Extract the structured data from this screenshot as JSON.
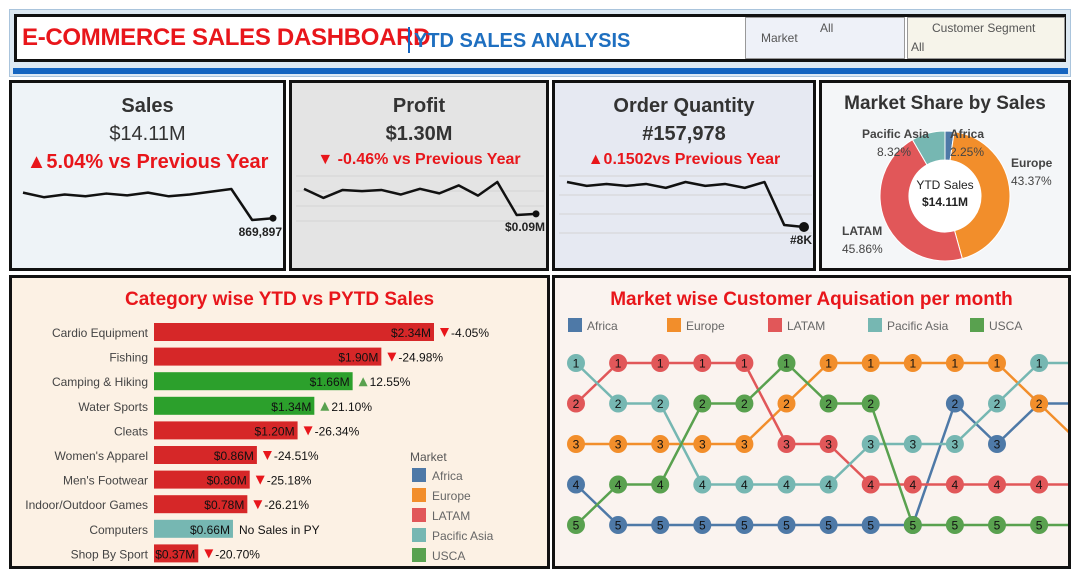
{
  "header": {
    "title": "E-COMMERCE SALES DASHBOARD",
    "subtitle": "YTD SALES ANALYSIS",
    "filters": [
      {
        "label": "Market",
        "value": "All"
      },
      {
        "label": "Customer Segment",
        "value": "All"
      }
    ]
  },
  "kpis": {
    "sales": {
      "title": "Sales",
      "value": "$14.11M",
      "change": "▲5.04% vs Previous Year",
      "last_label": "869,897"
    },
    "profit": {
      "title": "Profit",
      "value": "$1.30M",
      "change": "▼ -0.46% vs Previous Year",
      "last_label": "$0.09M"
    },
    "orders": {
      "title": "Order Quantity",
      "value": "#157,978",
      "change": "▲0.1502vs Previous Year",
      "last_label": "#8K"
    }
  },
  "colors": {
    "Africa": "#4e79a7",
    "Europe": "#f28e2b",
    "LATAM": "#e15759",
    "Pacific Asia": "#76b7b2",
    "USCA": "#59a14f",
    "bar_negative": "#d62728",
    "bar_positive": "#2ca02c",
    "bar_nodata": "#76b7b2",
    "accent_red": "#e8161b"
  },
  "chart_data": [
    {
      "type": "line",
      "id": "sales_sparkline",
      "values": [
        1010000,
        985000,
        1000000,
        990000,
        1005000,
        995000,
        1010000,
        990000,
        1000000,
        1015000,
        1030000,
        860000,
        869897
      ],
      "end_label": "869,897",
      "grid": false
    },
    {
      "type": "line",
      "id": "profit_sparkline",
      "values": [
        0.112,
        0.104,
        0.111,
        0.11,
        0.111,
        0.107,
        0.112,
        0.108,
        0.115,
        0.106,
        0.118,
        0.089,
        0.09
      ],
      "end_label": "$0.09M",
      "grid": true
    },
    {
      "type": "line",
      "id": "orders_sparkline",
      "values": [
        13.3,
        13.1,
        13.2,
        13.1,
        13.2,
        13.0,
        13.3,
        13.1,
        13.2,
        13.0,
        13.3,
        11.1,
        11.0
      ],
      "end_label": "#8K",
      "grid": true
    },
    {
      "type": "pie",
      "title": "Market Share by Sales",
      "center_label": "YTD Sales",
      "center_value": "$14.11M",
      "slices": [
        {
          "name": "Africa",
          "value": 2.25,
          "label": "2.25%"
        },
        {
          "name": "Europe",
          "value": 43.37,
          "label": "43.37%"
        },
        {
          "name": "LATAM",
          "value": 45.86,
          "label": "45.86%"
        },
        {
          "name": "Pacific Asia",
          "value": 8.32,
          "label": "8.32%"
        }
      ]
    },
    {
      "type": "bar",
      "title": "Category wise YTD vs PYTD Sales",
      "legend_title": "Market",
      "legend": [
        "Africa",
        "Europe",
        "LATAM",
        "Pacific Asia",
        "USCA"
      ],
      "categories": [
        "Cardio Equipment",
        "Fishing",
        "Camping & Hiking",
        "Water Sports",
        "Cleats",
        "Women's Apparel",
        "Men's Footwear",
        "Indoor/Outdoor Games",
        "Computers",
        "Shop By Sport"
      ],
      "values": [
        2.34,
        1.9,
        1.66,
        1.34,
        1.2,
        0.86,
        0.8,
        0.78,
        0.66,
        0.37
      ],
      "value_labels": [
        "$2.34M",
        "$1.90M",
        "$1.66M",
        "$1.34M",
        "$1.20M",
        "$0.86M",
        "$0.80M",
        "$0.78M",
        "$0.66M",
        "$0.37M"
      ],
      "change_labels": [
        "-4.05%",
        "-24.98%",
        "12.55%",
        "21.10%",
        "-26.34%",
        "-24.51%",
        "-25.18%",
        "-26.21%",
        "No Sales in PY",
        "-20.70%"
      ],
      "change_dir": [
        "down",
        "down",
        "up",
        "up",
        "down",
        "down",
        "down",
        "down",
        "none",
        "down"
      ],
      "xlim": [
        0,
        2.52
      ]
    },
    {
      "type": "line",
      "subtype": "bump",
      "title": "Market wise Customer Aquisation per month",
      "series": [
        {
          "name": "Africa",
          "ranks": [
            4,
            5,
            5,
            5,
            5,
            5,
            5,
            5,
            5,
            2,
            3,
            2,
            2
          ]
        },
        {
          "name": "Europe",
          "ranks": [
            3,
            3,
            3,
            3,
            3,
            2,
            1,
            1,
            1,
            1,
            1,
            2,
            3
          ]
        },
        {
          "name": "LATAM",
          "ranks": [
            2,
            1,
            1,
            1,
            1,
            3,
            3,
            4,
            4,
            4,
            4,
            4,
            4
          ]
        },
        {
          "name": "Pacific Asia",
          "ranks": [
            1,
            2,
            2,
            4,
            4,
            4,
            4,
            3,
            3,
            3,
            2,
            1,
            1
          ]
        },
        {
          "name": "USCA",
          "ranks": [
            5,
            4,
            4,
            2,
            2,
            1,
            2,
            2,
            5,
            5,
            5,
            5,
            5
          ]
        }
      ]
    }
  ]
}
